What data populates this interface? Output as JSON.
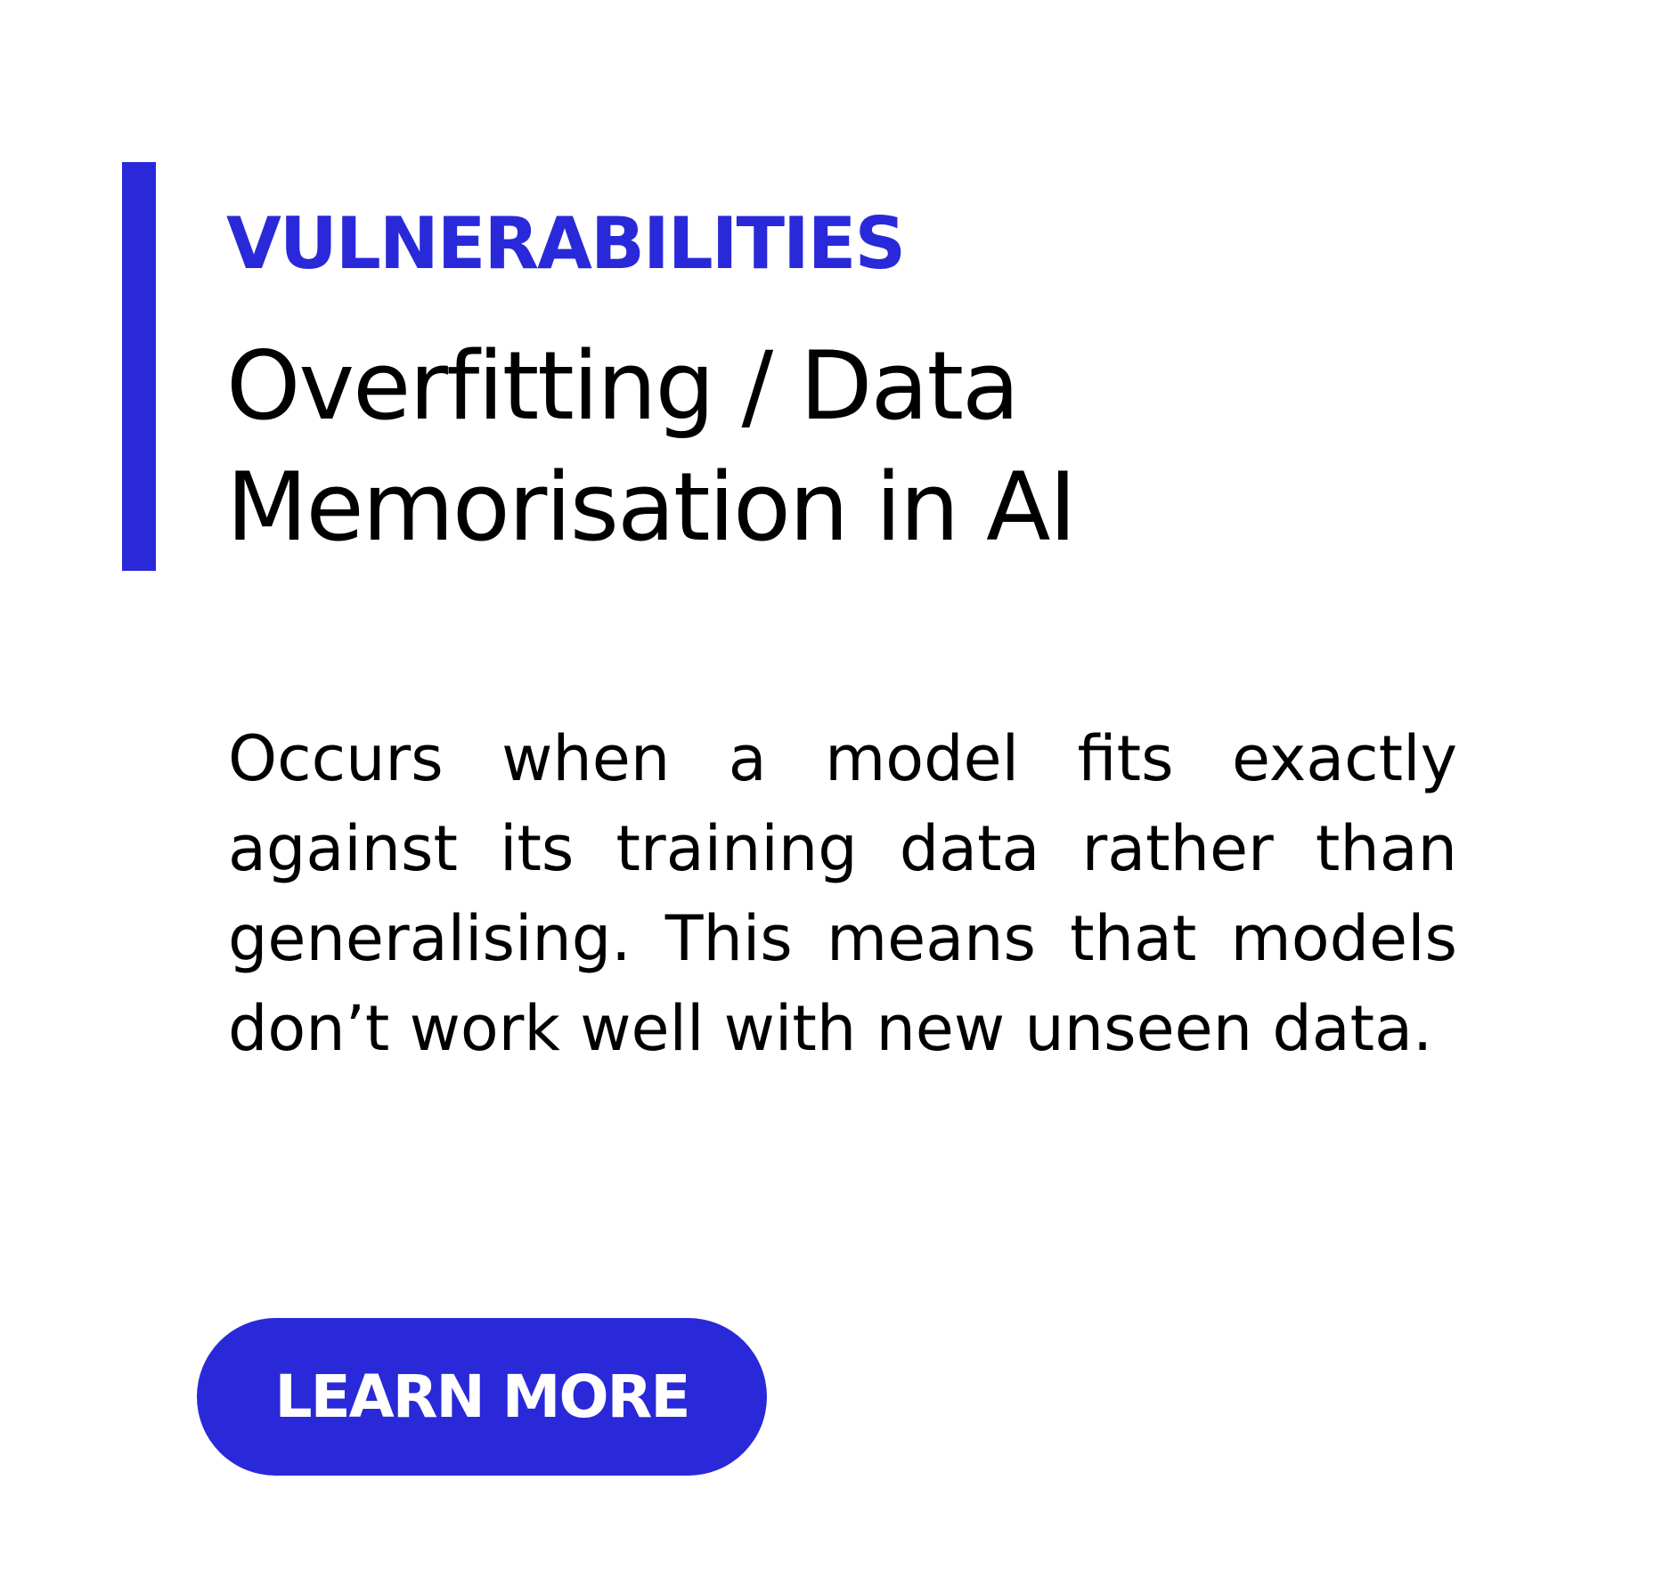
{
  "theme": {
    "accent_color": "#2929d9",
    "text_color": "#000000",
    "background_color": "#ffffff",
    "button_text_color": "#ffffff"
  },
  "card": {
    "eyebrow": "VULNERABILITIES",
    "title_lines": [
      "Overfitting / Data",
      "Memorisation in AI"
    ],
    "description": "Occurs when a model fits exactly against its training data rather than generalising. This means that models don’t work well with new unseen data.",
    "cta_label": "LEARN MORE"
  }
}
